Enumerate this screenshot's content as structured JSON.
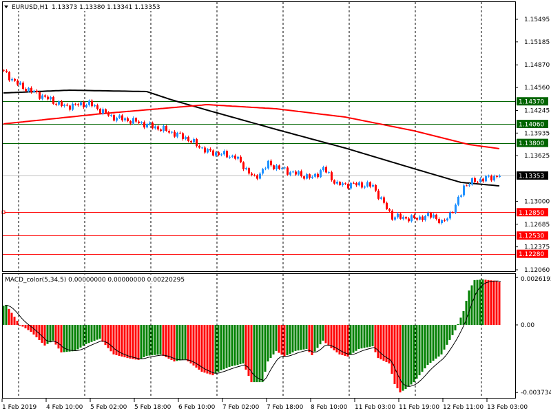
{
  "header": {
    "symbol_timeframe": "EURUSD,H1",
    "ohlc": "1.13373 1.13380 1.13341 1.13353",
    "menu_icon": "triangle-down-icon"
  },
  "macd_header": "MACD_color(5,34,5) 0.00000000 0.00000000 0.00220295",
  "colors": {
    "bull": "#1e90ff",
    "bear": "#ff0000",
    "support": "#ff0000",
    "resistance": "#006400",
    "ma_fast": "#000000",
    "ma_slow": "#ff0000",
    "hist_up": "#008000",
    "hist_down": "#ff0000",
    "bid_line": "#c0c0c0"
  },
  "chart_data": [
    {
      "type": "candlestick",
      "title": "EURUSD,H1",
      "bars": 181,
      "ylim": [
        1.1206,
        1.15495
      ],
      "price_ticks": [
        "1.15495",
        "1.15185",
        "1.14870",
        "1.14560",
        "1.14245",
        "1.13935",
        "1.13625",
        "1.13000",
        "1.12685",
        "1.12375",
        "1.12060"
      ],
      "time_labels": [
        {
          "bar": 0,
          "label": "1 Feb 2019"
        },
        {
          "bar": 16,
          "label": "4 Feb 10:00"
        },
        {
          "bar": 32,
          "label": "5 Feb 02:00"
        },
        {
          "bar": 48,
          "label": "5 Feb 18:00"
        },
        {
          "bar": 64,
          "label": "6 Feb 10:00"
        },
        {
          "bar": 80,
          "label": "7 Feb 02:00"
        },
        {
          "bar": 96,
          "label": "7 Feb 18:00"
        },
        {
          "bar": 112,
          "label": "8 Feb 10:00"
        },
        {
          "bar": 128,
          "label": "11 Feb 03:00"
        },
        {
          "bar": 144,
          "label": "11 Feb 19:00"
        },
        {
          "bar": 160,
          "label": "12 Feb 11:00"
        },
        {
          "bar": 176,
          "label": "13 Feb 03:00"
        }
      ],
      "close_path": [
        [
          0,
          1.1477
        ],
        [
          6,
          1.1458
        ],
        [
          14,
          1.1444
        ],
        [
          22,
          1.143
        ],
        [
          31,
          1.1434
        ],
        [
          39,
          1.1416
        ],
        [
          49,
          1.1408
        ],
        [
          59,
          1.1397
        ],
        [
          66,
          1.1387
        ],
        [
          74,
          1.1368
        ],
        [
          84,
          1.1361
        ],
        [
          91,
          1.1331
        ],
        [
          96,
          1.1351
        ],
        [
          104,
          1.134
        ],
        [
          112,
          1.1332
        ],
        [
          116,
          1.1345
        ],
        [
          121,
          1.1323
        ],
        [
          129,
          1.1323
        ],
        [
          134,
          1.1321
        ],
        [
          137,
          1.1302
        ],
        [
          141,
          1.1279
        ],
        [
          149,
          1.1276
        ],
        [
          156,
          1.1281
        ],
        [
          159,
          1.1269
        ],
        [
          164,
          1.1293
        ],
        [
          167,
          1.1321
        ],
        [
          171,
          1.1328
        ],
        [
          176,
          1.1332
        ],
        [
          180,
          1.13353
        ]
      ],
      "ma_black": [
        [
          0,
          1.14485
        ],
        [
          24,
          1.14523
        ],
        [
          52,
          1.14504
        ],
        [
          61,
          1.14391
        ],
        [
          74,
          1.14249
        ],
        [
          99,
          1.13985
        ],
        [
          124,
          1.1373
        ],
        [
          149,
          1.13447
        ],
        [
          166,
          1.13259
        ],
        [
          180,
          1.13211
        ]
      ],
      "ma_red": [
        [
          0,
          1.14061
        ],
        [
          36,
          1.14202
        ],
        [
          74,
          1.14325
        ],
        [
          99,
          1.14268
        ],
        [
          124,
          1.14155
        ],
        [
          149,
          1.13966
        ],
        [
          169,
          1.13778
        ],
        [
          180,
          1.13721
        ]
      ],
      "levels": [
        {
          "price": "1.14370",
          "kind": "resistance"
        },
        {
          "price": "1.14060",
          "kind": "resistance"
        },
        {
          "price": "1.13800",
          "kind": "resistance"
        },
        {
          "price": "1.12850",
          "kind": "support"
        },
        {
          "price": "1.12530",
          "kind": "support"
        },
        {
          "price": "1.12280",
          "kind": "support"
        }
      ],
      "current_price": "1.13353"
    },
    {
      "type": "bar",
      "title": "MACD_color(5,34,5)",
      "ylim": [
        -0.003734,
        0.0026192
      ],
      "ticks": [
        "0.0026192",
        "0.00",
        "-0.003734"
      ],
      "histogram_path": [
        [
          0,
          0.00106
        ],
        [
          1,
          0.0011
        ],
        [
          5,
          0.00023
        ],
        [
          6,
          0.0
        ],
        [
          10,
          -0.00038
        ],
        [
          14,
          -0.00099
        ],
        [
          15,
          -0.00114
        ],
        [
          18,
          -0.00087
        ],
        [
          21,
          -0.00152
        ],
        [
          26,
          -0.00144
        ],
        [
          30,
          -0.00106
        ],
        [
          35,
          -0.00076
        ],
        [
          40,
          -0.00163
        ],
        [
          45,
          -0.00183
        ],
        [
          49,
          -0.00194
        ],
        [
          52,
          -0.00171
        ],
        [
          57,
          -0.00163
        ],
        [
          62,
          -0.00202
        ],
        [
          66,
          -0.0019
        ],
        [
          72,
          -0.00259
        ],
        [
          76,
          -0.00278
        ],
        [
          79,
          -0.00251
        ],
        [
          82,
          -0.00232
        ],
        [
          87,
          -0.00213
        ],
        [
          90,
          -0.00316
        ],
        [
          94,
          -0.00316
        ],
        [
          96,
          -0.00202
        ],
        [
          99,
          -0.00144
        ],
        [
          102,
          -0.00175
        ],
        [
          106,
          -0.00144
        ],
        [
          110,
          -0.00133
        ],
        [
          112,
          -0.00167
        ],
        [
          116,
          -0.00087
        ],
        [
          119,
          -0.00129
        ],
        [
          122,
          -0.00163
        ],
        [
          125,
          -0.00175
        ],
        [
          129,
          -0.00133
        ],
        [
          134,
          -0.00118
        ],
        [
          136,
          -0.00183
        ],
        [
          140,
          -0.00213
        ],
        [
          142,
          -0.00327
        ],
        [
          144,
          -0.00373
        ],
        [
          146,
          -0.00354
        ],
        [
          149,
          -0.00316
        ],
        [
          154,
          -0.00221
        ],
        [
          159,
          -0.00163
        ],
        [
          164,
          -0.0003
        ],
        [
          165,
          4e-05
        ],
        [
          167,
          0.00076
        ],
        [
          169,
          0.0019
        ],
        [
          171,
          0.00247
        ],
        [
          174,
          0.00251
        ],
        [
          179,
          0.00243
        ],
        [
          180,
          0.00236
        ]
      ]
    }
  ]
}
